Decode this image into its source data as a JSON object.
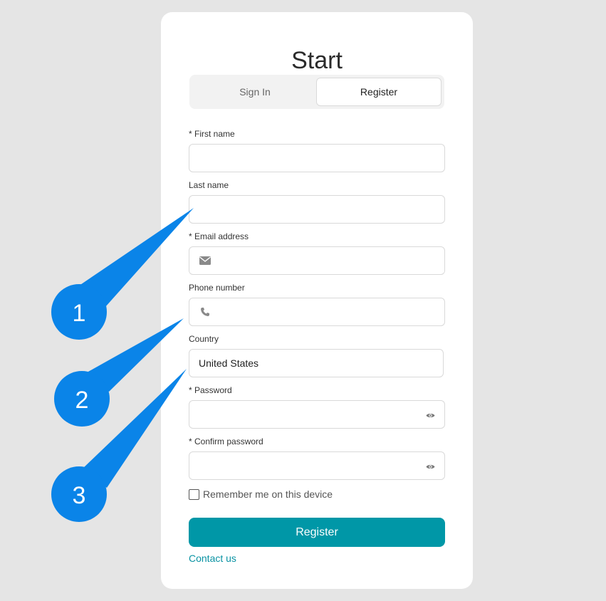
{
  "form": {
    "title": "Start",
    "tabs": [
      {
        "label": "Sign In",
        "active": false
      },
      {
        "label": "Register",
        "active": true
      }
    ],
    "fields": {
      "first_name": {
        "label": "* First name",
        "value": ""
      },
      "last_name": {
        "label": "Last name",
        "value": ""
      },
      "email": {
        "label": "* Email address",
        "value": "",
        "icon": "envelope-icon"
      },
      "phone": {
        "label": "Phone number",
        "value": "",
        "icon": "phone-icon"
      },
      "country": {
        "label": "Country",
        "value": "United States"
      },
      "password": {
        "label": "* Password",
        "value": "",
        "icon": "eye-icon"
      },
      "confirm_password": {
        "label": "* Confirm password",
        "value": "",
        "icon": "eye-icon"
      }
    },
    "remember_me": {
      "label": "Remember me on this device",
      "checked": false
    },
    "submit_label": "Register",
    "contact_link": "Contact us"
  },
  "annotations": [
    {
      "number": "1"
    },
    {
      "number": "2"
    },
    {
      "number": "3"
    }
  ],
  "colors": {
    "background": "#e5e5e5",
    "accent": "#0097a7",
    "annotation": "#0a84e8"
  }
}
